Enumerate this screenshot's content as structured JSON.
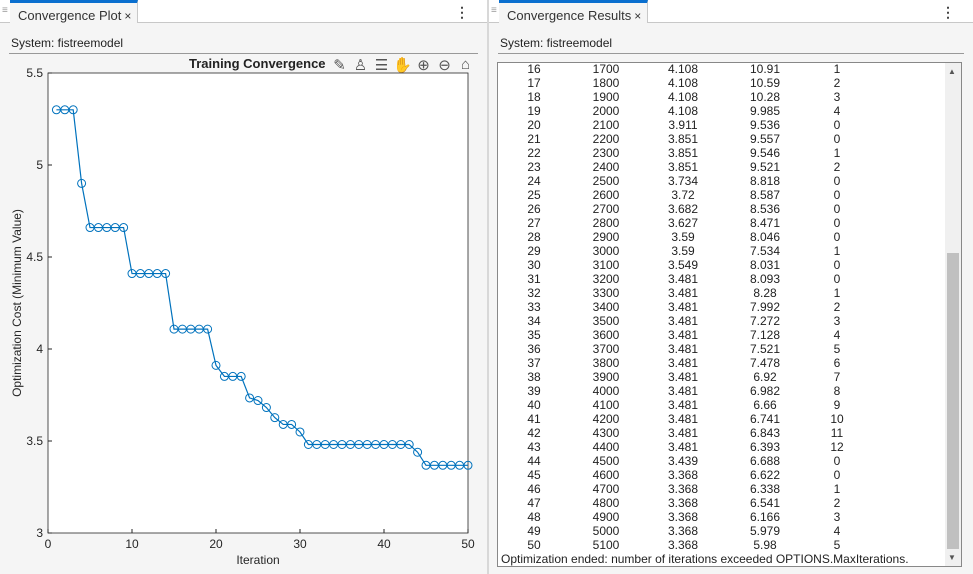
{
  "left": {
    "tab": "Convergence Plot",
    "system": "System: fistreemodel"
  },
  "right": {
    "tab": "Convergence Results",
    "system": "System: fistreemodel"
  },
  "chart_data": {
    "type": "line",
    "title": "Training Convergence",
    "xlabel": "Iteration",
    "ylabel": "Optimization Cost (Minimum Value)",
    "xlim": [
      0,
      50
    ],
    "ylim": [
      3,
      5.5
    ],
    "xticks": [
      0,
      10,
      20,
      30,
      40,
      50
    ],
    "yticks": [
      3,
      3.5,
      4,
      4.5,
      5,
      5.5
    ],
    "ytick_labels": [
      "3",
      "3.5",
      "4",
      "4.5",
      "5",
      "5.5"
    ],
    "color": "#0072bd",
    "marker": "circle",
    "x": [
      1,
      2,
      3,
      4,
      5,
      6,
      7,
      8,
      9,
      10,
      11,
      12,
      13,
      14,
      15,
      16,
      17,
      18,
      19,
      20,
      21,
      22,
      23,
      24,
      25,
      26,
      27,
      28,
      29,
      30,
      31,
      32,
      33,
      34,
      35,
      36,
      37,
      38,
      39,
      40,
      41,
      42,
      43,
      44,
      45,
      46,
      47,
      48,
      49,
      50
    ],
    "y": [
      5.3,
      5.3,
      5.3,
      4.9,
      4.66,
      4.66,
      4.66,
      4.66,
      4.66,
      4.41,
      4.41,
      4.41,
      4.41,
      4.41,
      4.108,
      4.108,
      4.108,
      4.108,
      4.108,
      3.911,
      3.851,
      3.851,
      3.851,
      3.734,
      3.72,
      3.682,
      3.627,
      3.59,
      3.59,
      3.549,
      3.481,
      3.481,
      3.481,
      3.481,
      3.481,
      3.481,
      3.481,
      3.481,
      3.481,
      3.481,
      3.481,
      3.481,
      3.481,
      3.439,
      3.368,
      3.368,
      3.368,
      3.368,
      3.368,
      3.368
    ]
  },
  "results": {
    "rows": [
      [
        "16",
        "1700",
        "4.108",
        "10.91",
        "1"
      ],
      [
        "17",
        "1800",
        "4.108",
        "10.59",
        "2"
      ],
      [
        "18",
        "1900",
        "4.108",
        "10.28",
        "3"
      ],
      [
        "19",
        "2000",
        "4.108",
        "9.985",
        "4"
      ],
      [
        "20",
        "2100",
        "3.911",
        "9.536",
        "0"
      ],
      [
        "21",
        "2200",
        "3.851",
        "9.557",
        "0"
      ],
      [
        "22",
        "2300",
        "3.851",
        "9.546",
        "1"
      ],
      [
        "23",
        "2400",
        "3.851",
        "9.521",
        "2"
      ],
      [
        "24",
        "2500",
        "3.734",
        "8.818",
        "0"
      ],
      [
        "25",
        "2600",
        "3.72",
        "8.587",
        "0"
      ],
      [
        "26",
        "2700",
        "3.682",
        "8.536",
        "0"
      ],
      [
        "27",
        "2800",
        "3.627",
        "8.471",
        "0"
      ],
      [
        "28",
        "2900",
        "3.59",
        "8.046",
        "0"
      ],
      [
        "29",
        "3000",
        "3.59",
        "7.534",
        "1"
      ],
      [
        "30",
        "3100",
        "3.549",
        "8.031",
        "0"
      ],
      [
        "31",
        "3200",
        "3.481",
        "8.093",
        "0"
      ],
      [
        "32",
        "3300",
        "3.481",
        "8.28",
        "1"
      ],
      [
        "33",
        "3400",
        "3.481",
        "7.992",
        "2"
      ],
      [
        "34",
        "3500",
        "3.481",
        "7.272",
        "3"
      ],
      [
        "35",
        "3600",
        "3.481",
        "7.128",
        "4"
      ],
      [
        "36",
        "3700",
        "3.481",
        "7.521",
        "5"
      ],
      [
        "37",
        "3800",
        "3.481",
        "7.478",
        "6"
      ],
      [
        "38",
        "3900",
        "3.481",
        "6.92",
        "7"
      ],
      [
        "39",
        "4000",
        "3.481",
        "6.982",
        "8"
      ],
      [
        "40",
        "4100",
        "3.481",
        "6.66",
        "9"
      ],
      [
        "41",
        "4200",
        "3.481",
        "6.741",
        "10"
      ],
      [
        "42",
        "4300",
        "3.481",
        "6.843",
        "11"
      ],
      [
        "43",
        "4400",
        "3.481",
        "6.393",
        "12"
      ],
      [
        "44",
        "4500",
        "3.439",
        "6.688",
        "0"
      ],
      [
        "45",
        "4600",
        "3.368",
        "6.622",
        "0"
      ],
      [
        "46",
        "4700",
        "3.368",
        "6.338",
        "1"
      ],
      [
        "47",
        "4800",
        "3.368",
        "6.541",
        "2"
      ],
      [
        "48",
        "4900",
        "3.368",
        "6.166",
        "3"
      ],
      [
        "49",
        "5000",
        "3.368",
        "5.979",
        "4"
      ],
      [
        "50",
        "5100",
        "3.368",
        "5.98",
        "5"
      ]
    ],
    "message": "Optimization ended: number of iterations exceeded OPTIONS.MaxIterations."
  },
  "icons": {
    "close": "×",
    "kebab": "⋮"
  }
}
